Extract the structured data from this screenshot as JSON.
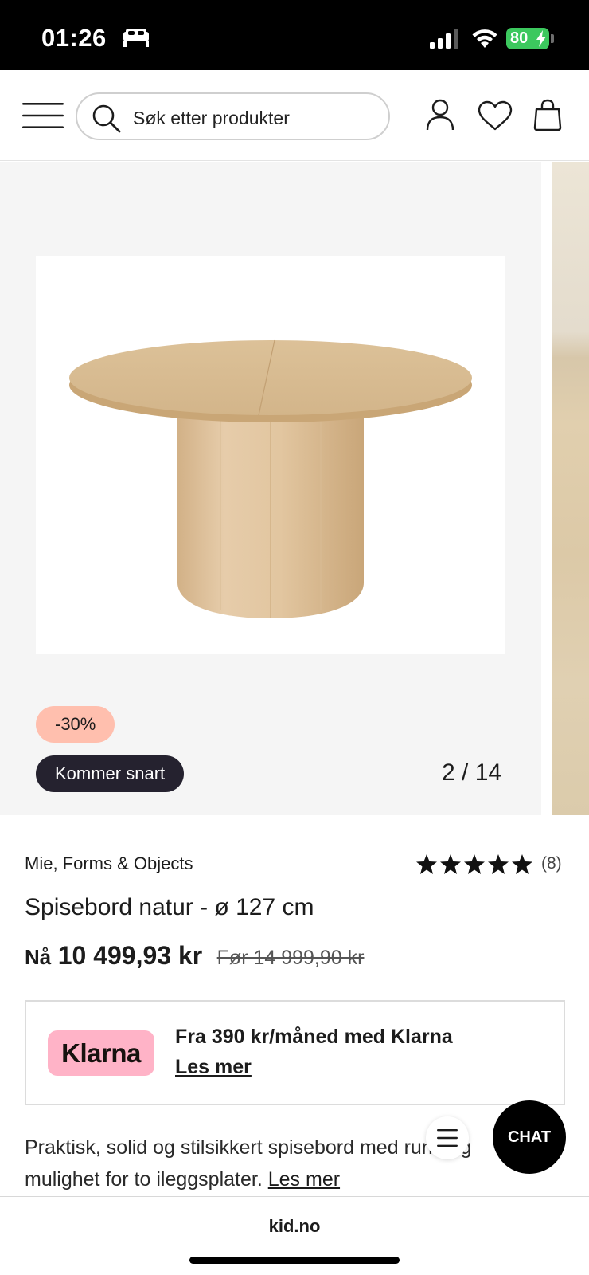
{
  "status_bar": {
    "time": "01:26",
    "battery": "80",
    "battery_color": "#3cc85e"
  },
  "header": {
    "search_placeholder": "Søk etter produkter",
    "icons": [
      "menu-icon",
      "search-icon",
      "user-icon",
      "heart-icon",
      "shopping-bag-icon"
    ]
  },
  "gallery": {
    "discount_badge": "-30%",
    "status_badge": "Kommer snart",
    "counter": "2 / 14"
  },
  "product": {
    "brand": "Mie, Forms & Objects",
    "rating_stars": 5,
    "rating_count": "(8)",
    "title": "Spisebord natur - ø 127 cm",
    "price_now_label": "Nå",
    "price_now": "10 499,93 kr",
    "price_before": "Før 14 999,90 kr"
  },
  "klarna": {
    "logo_text": "Klarna",
    "text": "Fra 390 kr/måned med Klarna",
    "link": "Les mer",
    "logo_color": "#ffb3c7"
  },
  "description": {
    "text": "Praktisk, solid og stilsikkert spisebord med rund og mulighet for to ileggsplater.",
    "link": "Les mer"
  },
  "fab": {
    "chat": "CHAT"
  },
  "browser": {
    "url": "kid.no"
  },
  "colors": {
    "discount_badge": "#ffbfae",
    "status_badge": "#25222f",
    "gallery_bg": "#f5f5f5"
  }
}
